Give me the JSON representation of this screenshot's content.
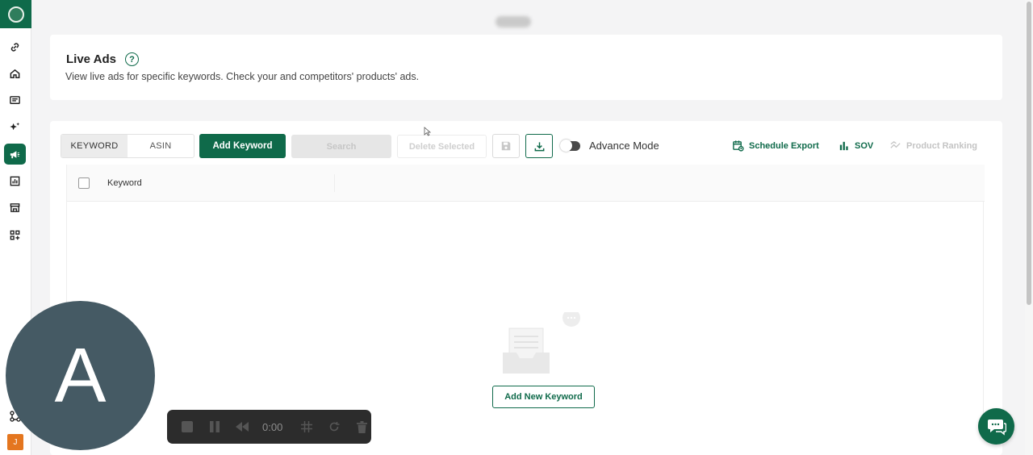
{
  "header": {
    "title": "Live Ads",
    "help_glyph": "?",
    "description": "View live ads for specific keywords. Check your and competitors' products' ads."
  },
  "toolbar": {
    "tabs": [
      {
        "label": "KEYWORD",
        "active": true
      },
      {
        "label": "ASIN",
        "active": false
      }
    ],
    "add_keyword": "Add Keyword",
    "search": "Search",
    "delete_selected": "Delete Selected",
    "advance_mode": "Advance Mode",
    "advance_mode_on": false,
    "schedule_export": "Schedule Export",
    "sov": "SOV",
    "product_ranking": "Product Ranking"
  },
  "table": {
    "columns": [
      "Keyword"
    ],
    "rows": []
  },
  "empty_state": {
    "button": "Add New Keyword"
  },
  "sidebar": {
    "items": [
      {
        "icon": "link-icon"
      },
      {
        "icon": "home-icon"
      },
      {
        "icon": "message-icon"
      },
      {
        "icon": "sparkle-icon"
      },
      {
        "icon": "megaphone-icon",
        "active": true
      },
      {
        "icon": "chart-icon"
      },
      {
        "icon": "store-icon"
      },
      {
        "icon": "grid-plus-icon"
      }
    ],
    "user_initial": "J"
  },
  "overlay": {
    "camera_initial": "A",
    "recorder_time": "0:00"
  },
  "colors": {
    "brand": "#0f6a4a",
    "avatar_bg": "#455a64",
    "user_badge": "#e4761f"
  }
}
